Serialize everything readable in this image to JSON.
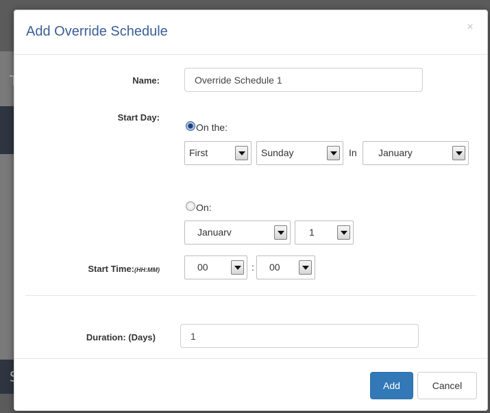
{
  "background": {
    "left_chars": [
      "T",
      "S"
    ]
  },
  "modal": {
    "title": "Add Override Schedule",
    "close_icon": "×"
  },
  "form": {
    "name": {
      "label": "Name:",
      "value": "Override Schedule 1"
    },
    "start_day": {
      "label": "Start Day:",
      "option_on_the": {
        "label": "On the:",
        "checked": true,
        "ordinal": "First",
        "weekday": "Sunday",
        "in_text": "In",
        "month": "January"
      },
      "option_on": {
        "label": "On:",
        "checked": false,
        "month": "Januarv",
        "day": "1"
      }
    },
    "start_time": {
      "label": "Start Time:",
      "label_hint": "(HH:MM)",
      "hour": "00",
      "separator": ":",
      "minute": "00"
    },
    "duration": {
      "label": "Duration: (Days)",
      "value": "1"
    }
  },
  "footer": {
    "add_label": "Add",
    "cancel_label": "Cancel"
  },
  "colors": {
    "title": "#3a5f94",
    "primary_button": "#3379b8"
  }
}
